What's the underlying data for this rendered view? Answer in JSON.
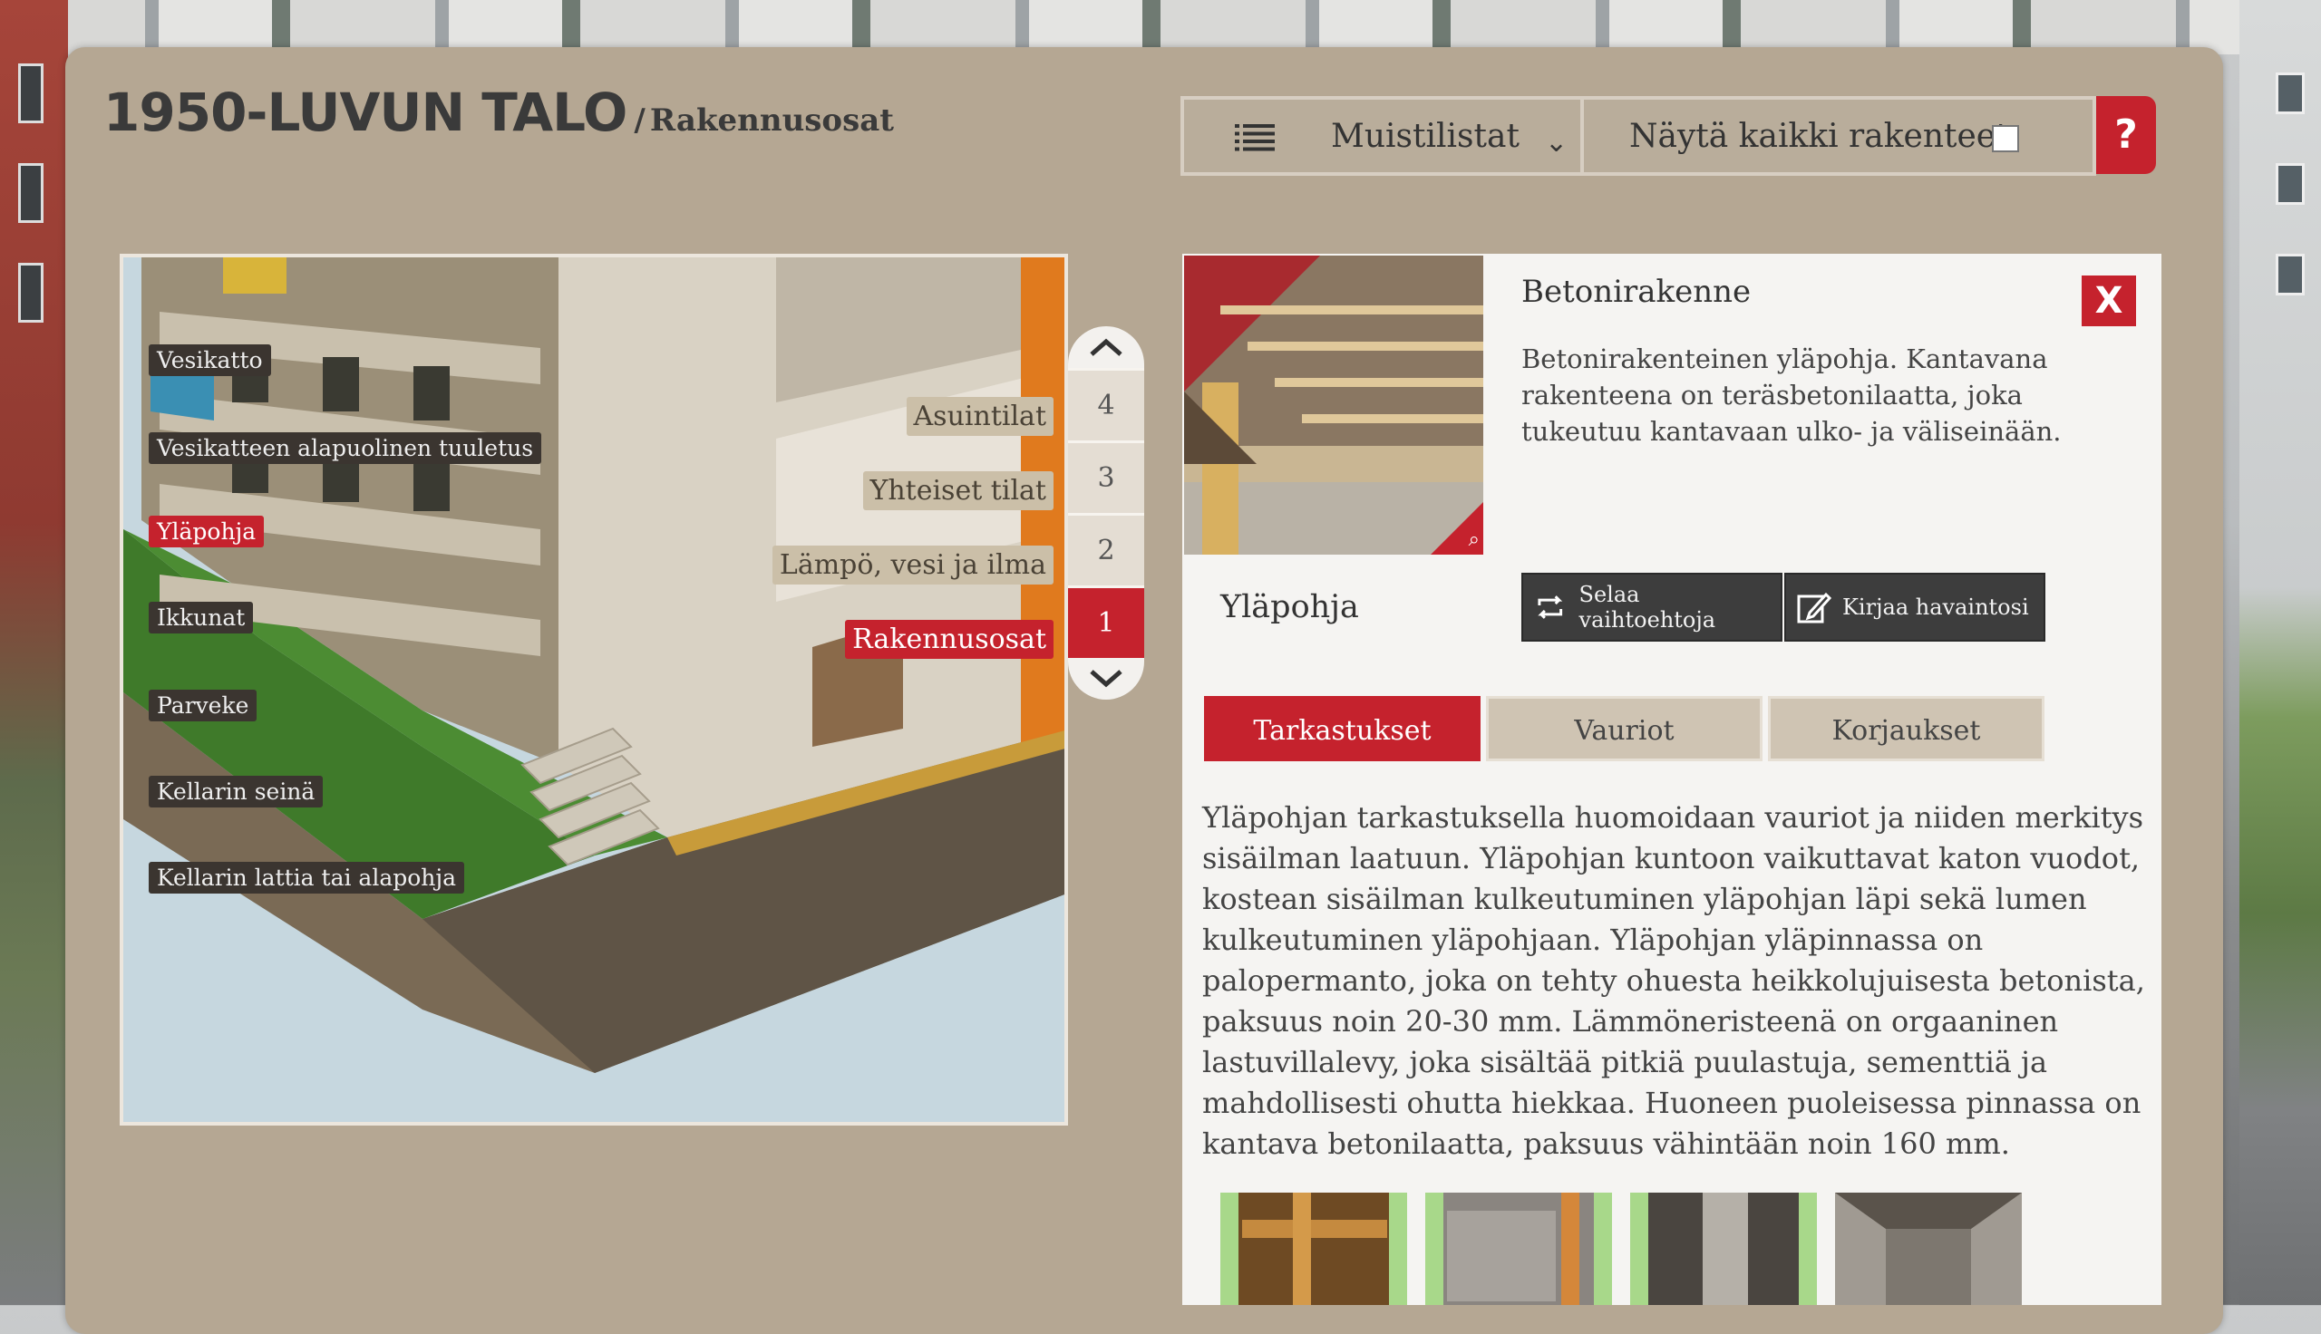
{
  "header": {
    "title": "1950-LUVUN TALO",
    "separator": "/",
    "subtitle": "Rakennusosat"
  },
  "toolbar": {
    "memo_label": "Muistilistat",
    "show_all_label": "Näytä kaikki rakenteet",
    "show_all_checked": false,
    "help_label": "?"
  },
  "building_tags": [
    {
      "label": "Vesikatto",
      "active": false
    },
    {
      "label": "Vesikatteen alapuolinen tuuletus",
      "active": false
    },
    {
      "label": "Yläpohja",
      "active": true
    },
    {
      "label": "Ikkunat",
      "active": false
    },
    {
      "label": "Parveke",
      "active": false
    },
    {
      "label": "Kellarin seinä",
      "active": false
    },
    {
      "label": "Kellarin lattia tai alapohja",
      "active": false
    }
  ],
  "floor_tags": [
    {
      "label": "Asuintilat",
      "active": false
    },
    {
      "label": "Yhteiset tilat",
      "active": false
    },
    {
      "label": "Lämpö, vesi ja ilma",
      "active": false
    },
    {
      "label": "Rakennusosat",
      "active": true
    }
  ],
  "floor_selector": {
    "buttons": [
      "4",
      "3",
      "2",
      "1"
    ],
    "active": "1"
  },
  "info": {
    "title": "Betonirakenne",
    "description": "Betonirakenteinen yläpohja. Kantavana rakenteena on teräsbetonilaatta, joka tukeutuu kantavaan ulko- ja väliseinään.",
    "close_label": "X",
    "part_name": "Yläpohja",
    "browse_label": "Selaa vaihtoehtoja",
    "record_label": "Kirjaa havaintosi",
    "tabs": [
      {
        "label": "Tarkastukset",
        "active": true
      },
      {
        "label": "Vauriot",
        "active": false
      },
      {
        "label": "Korjaukset",
        "active": false
      }
    ],
    "body": "Yläpohjan tarkastuksella huomoidaan vauriot ja niiden merkitys sisäilman laatuun. Yläpohjan kuntoon vaikuttavat katon vuodot, kostean sisäilman kulkeutuminen yläpohjan läpi sekä lumen kulkeutuminen yläpohjaan. Yläpohjan yläpinnassa on palopermanto, joka on tehty ohuesta heikkolujuisesta betonista, paksuus noin 20-30 mm. Lämmöneristeenä on orgaaninen lastuvillalevy, joka sisältää pitkiä puulastuja, sementtiä ja mahdollisesti ohutta hiekkaa. Huoneen puoleisessa pinnassa on kantava betonilaatta, paksuus vähintään noin 160 mm."
  },
  "colors": {
    "accent": "#c5222d",
    "panel": "#b5a793",
    "info_bg": "#f5f4f2"
  },
  "icons": [
    "list-icon",
    "chevron-down-icon",
    "help-icon",
    "chevron-up-icon",
    "zoom-icon",
    "close-icon",
    "repeat-icon",
    "edit-icon"
  ]
}
